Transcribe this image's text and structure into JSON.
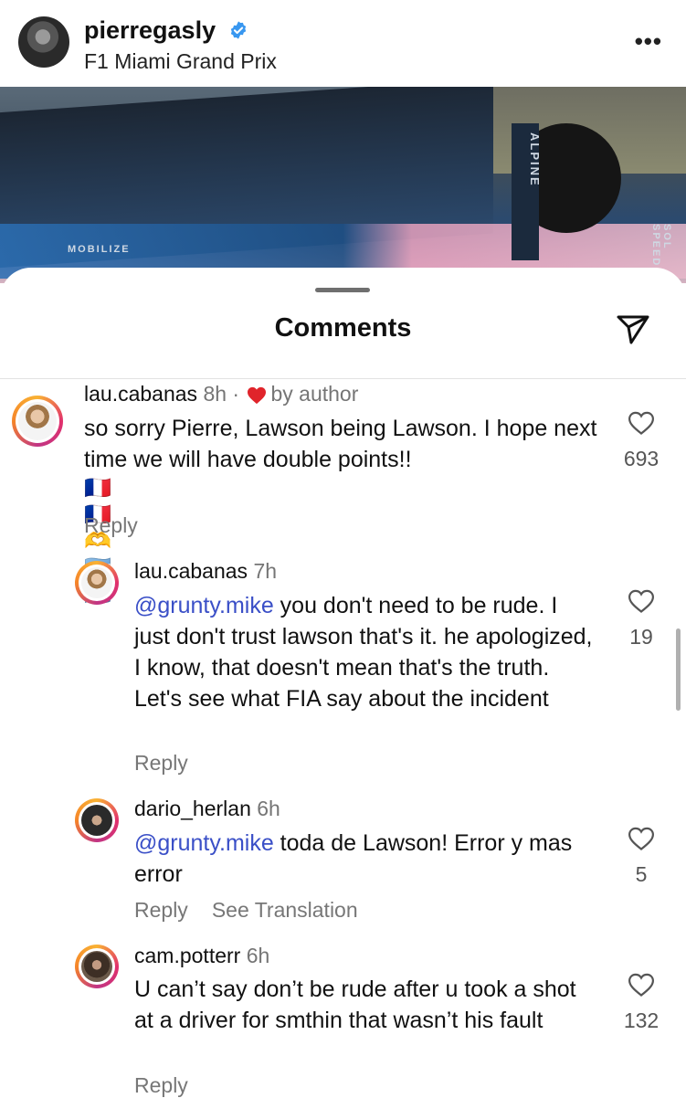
{
  "post": {
    "username": "pierregasly",
    "location": "F1 Miami Grand Prix",
    "more_label": "•••",
    "photo_texts": [
      "ALPINE",
      "MOBILIZE",
      "SOL SPEED"
    ]
  },
  "sheet": {
    "title": "Comments"
  },
  "comments": [
    {
      "username": "lau.cabanas",
      "time": "8h",
      "badge": "by author",
      "text": "so sorry Pierre, Lawson being Lawson. I hope next time we will have double points!!",
      "flags": "🇫🇷🇫🇷🫶🇦🇷🇦🇷",
      "likes": "693",
      "reply_label": "Reply"
    },
    {
      "username": "lau.cabanas",
      "time": "7h",
      "mention": "@grunty.mike",
      "text": " you don't need to be rude. I just don't trust lawson that's it. he apologized, I know, that doesn't mean that's the truth. Let's see what FIA say about the incident",
      "likes": "19",
      "reply_label": "Reply"
    },
    {
      "username": "dario_herlan",
      "time": "6h",
      "mention": "@grunty.mike",
      "text": " toda de Lawson! Error y mas error",
      "likes": "5",
      "reply_label": "Reply",
      "translation_label": "See Translation"
    },
    {
      "username": "cam.potterr",
      "time": "6h",
      "text": "U can’t say don’t be rude after u took a shot at a driver for smthin that wasn’t his fault",
      "likes": "132",
      "reply_label": "Reply"
    }
  ],
  "colors": {
    "mention": "#3a4fc7",
    "heart_red": "#e0242b",
    "verified_blue": "#3897f0"
  },
  "icons": [
    "verified-badge-icon",
    "more-options-icon",
    "share-icon",
    "heart-icon",
    "heart-outline-icon"
  ]
}
